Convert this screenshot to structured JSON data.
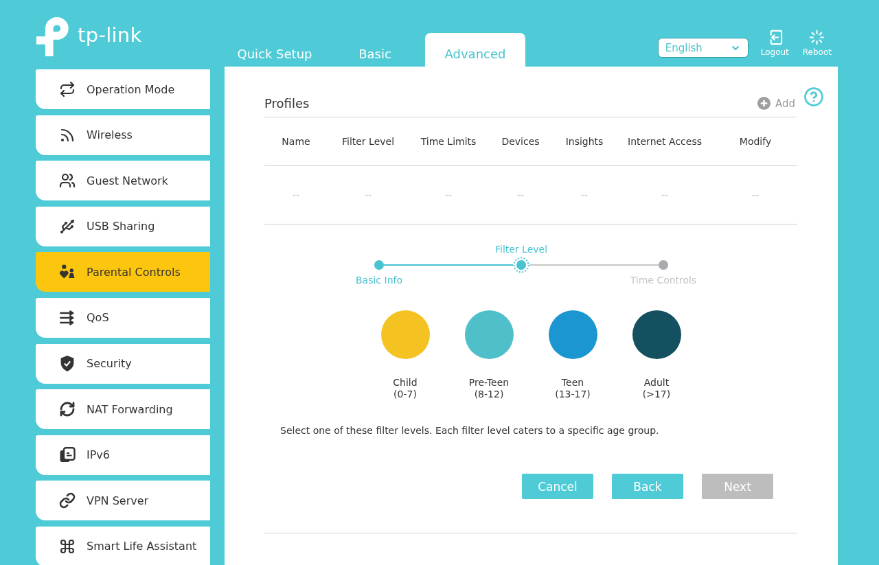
{
  "header": {
    "logo_text": "tp-link",
    "tabs": [
      {
        "label": "Quick Setup",
        "selected": false
      },
      {
        "label": "Basic",
        "selected": false
      },
      {
        "label": "Advanced",
        "selected": true
      }
    ],
    "language": {
      "value": "English"
    },
    "actions": [
      {
        "label": "Logout"
      },
      {
        "label": "Reboot"
      }
    ]
  },
  "sidebar": {
    "items": [
      {
        "label": "Operation Mode",
        "selected": false
      },
      {
        "label": "Wireless",
        "selected": false
      },
      {
        "label": "Guest Network",
        "selected": false
      },
      {
        "label": "USB Sharing",
        "selected": false
      },
      {
        "label": "Parental Controls",
        "selected": true
      },
      {
        "label": "QoS",
        "selected": false
      },
      {
        "label": "Security",
        "selected": false
      },
      {
        "label": "NAT Forwarding",
        "selected": false
      },
      {
        "label": "IPv6",
        "selected": false
      },
      {
        "label": "VPN Server",
        "selected": false
      },
      {
        "label": "Smart Life Assistant",
        "selected": false
      }
    ]
  },
  "profiles": {
    "title": "Profiles",
    "add_label": "Add",
    "table": {
      "columns": [
        "Name",
        "Filter Level",
        "Time Limits",
        "Devices",
        "Insights",
        "Internet Access",
        "Modify"
      ],
      "rows": [
        [
          "--",
          "--",
          "--",
          "--",
          "--",
          "--",
          "--"
        ]
      ]
    }
  },
  "stepper": {
    "steps": [
      {
        "label": "Basic Info",
        "completed": true,
        "selected": false
      },
      {
        "label": "Filter Level",
        "completed": false,
        "selected": true
      },
      {
        "label": "Time Controls",
        "completed": false,
        "selected": false
      }
    ]
  },
  "filter_levels": [
    {
      "name": "Child",
      "ages": "(0-7)",
      "color": "#f4c322",
      "selected": false
    },
    {
      "name": "Pre-Teen",
      "ages": "(8-12)",
      "color": "#4fc0c9",
      "selected": false
    },
    {
      "name": "Teen",
      "ages": "(13-17)",
      "color": "#1c96d0",
      "selected": false
    },
    {
      "name": "Adult",
      "ages": "(>17)",
      "color": "#14505f",
      "selected": false
    }
  ],
  "hint": "Select one of these filter levels. Each filter level caters to a specific age group.",
  "buttons": [
    {
      "label": "Cancel",
      "disabled": false
    },
    {
      "label": "Back",
      "disabled": false
    },
    {
      "label": "Next",
      "disabled": true
    }
  ]
}
